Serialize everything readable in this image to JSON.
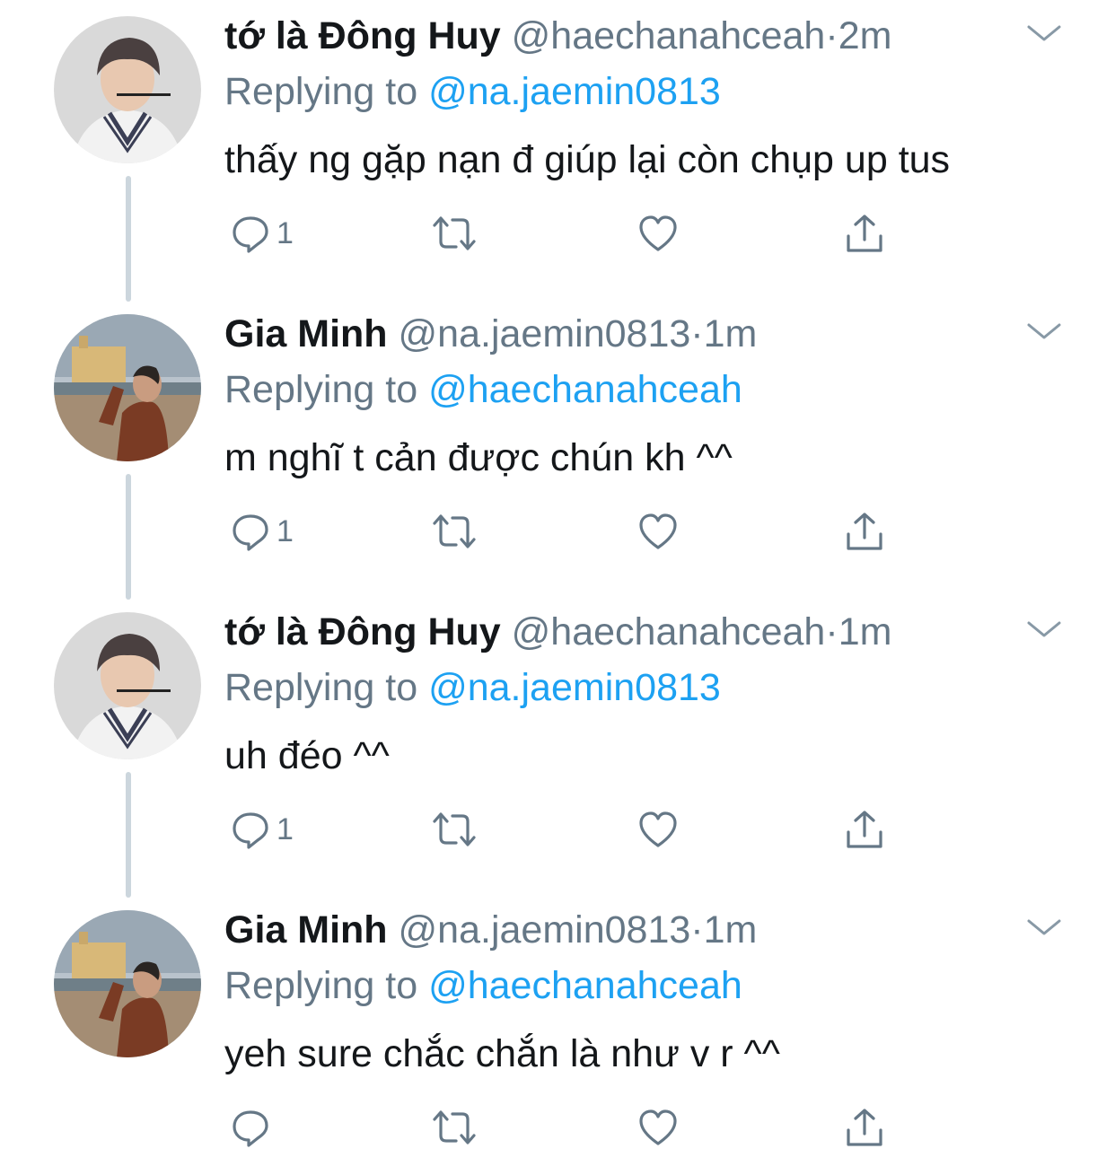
{
  "tweets": [
    {
      "name": "tớ là Đông Huy",
      "handle": "@haechanahceah",
      "dot": "·",
      "time": "2m",
      "replying_prefix": "Replying to ",
      "replying_to": "@na.jaemin0813",
      "text": "thấy ng gặp nạn đ giúp lại còn chụp up tus",
      "reply_count": "1",
      "avatar": "avatar-dong-huy"
    },
    {
      "name": "Gia Minh",
      "handle": "@na.jaemin0813",
      "dot": "·",
      "time": "1m",
      "replying_prefix": "Replying to ",
      "replying_to": "@haechanahceah",
      "text": "m nghĩ t cản được chún kh ^^",
      "reply_count": "1",
      "avatar": "avatar-gia-minh"
    },
    {
      "name": "tớ là Đông Huy",
      "handle": "@haechanahceah",
      "dot": "·",
      "time": "1m",
      "replying_prefix": "Replying to ",
      "replying_to": "@na.jaemin0813",
      "text": "uh đéo ^^",
      "reply_count": "1",
      "avatar": "avatar-dong-huy"
    },
    {
      "name": "Gia Minh",
      "handle": "@na.jaemin0813",
      "dot": "·",
      "time": "1m",
      "replying_prefix": "Replying to ",
      "replying_to": "@haechanahceah",
      "text": "yeh sure chắc chắn là như v r ^^",
      "reply_count": "",
      "avatar": "avatar-gia-minh"
    }
  ],
  "colors": {
    "name": "#14171a",
    "muted": "#657786",
    "mention": "#1da1f2",
    "thread_line": "#ccd6dd"
  },
  "icons": {
    "reply": "reply-icon",
    "retweet": "retweet-icon",
    "like": "heart-icon",
    "share": "share-icon",
    "menu": "chevron-down-icon"
  }
}
